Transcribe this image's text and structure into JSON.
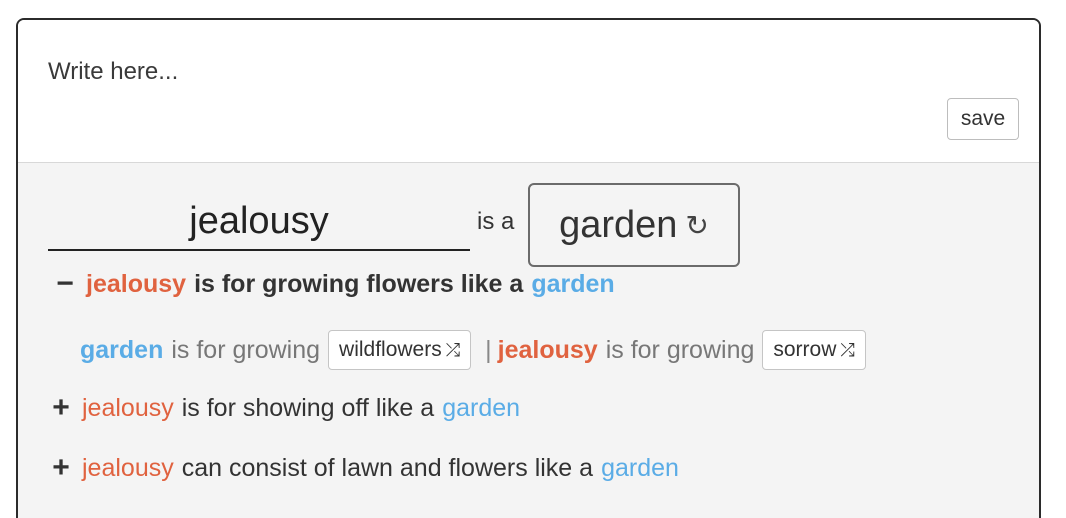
{
  "editor": {
    "placeholder": "Write here...",
    "save_label": "save"
  },
  "metaphor": {
    "subject": "jealousy",
    "connector": "is a",
    "vehicle": "garden",
    "refresh_icon": "refresh-icon"
  },
  "expanded": {
    "toggle": "−",
    "subject": "jealousy",
    "text": "is for growing flowers like a",
    "vehicle": "garden",
    "detail": {
      "left_word": "garden",
      "left_text": "is for growing",
      "left_choice": "wildflowers",
      "separator": "|",
      "right_word": "jealousy",
      "right_text": "is for growing",
      "right_choice": "sorrow",
      "shuffle_icon": "shuffle-icon"
    }
  },
  "collapsed": [
    {
      "toggle": "+",
      "subject": "jealousy",
      "text": "is for showing off like a",
      "vehicle": "garden"
    },
    {
      "toggle": "+",
      "subject": "jealousy",
      "text": "can consist of lawn and flowers like a",
      "vehicle": "garden"
    }
  ],
  "colors": {
    "tenor": "#e0623f",
    "vehicle": "#5aace6"
  }
}
